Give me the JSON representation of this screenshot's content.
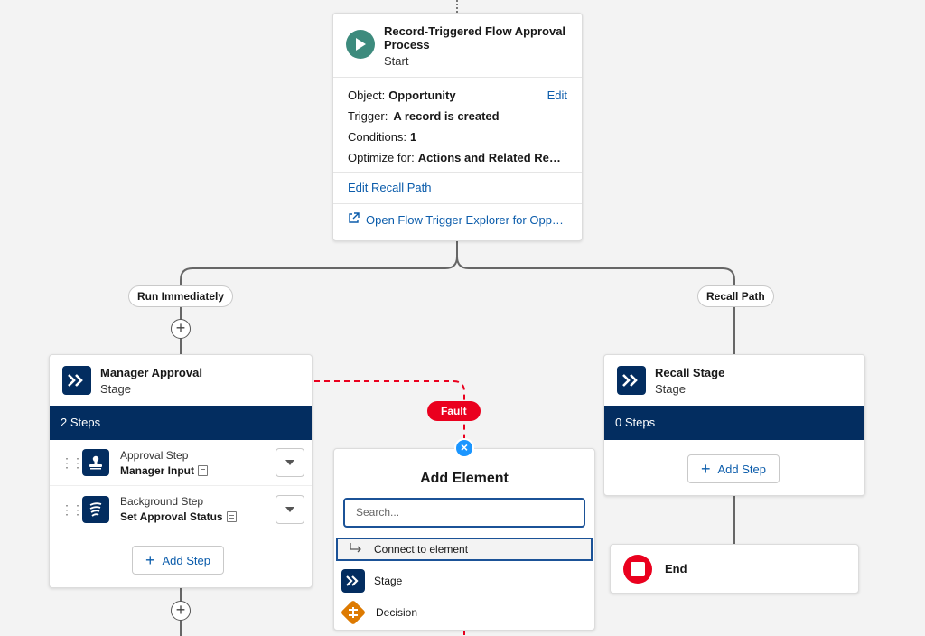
{
  "start": {
    "title": "Record-Triggered Flow Approval Process",
    "subtitle": "Start",
    "object_label": "Object:",
    "object_value": "Opportunity",
    "edit_label": "Edit",
    "trigger_label": "Trigger:",
    "trigger_value": "A record is created",
    "conditions_label": "Conditions:",
    "conditions_value": "1",
    "optimize_label": "Optimize for:",
    "optimize_value": "Actions and Related Rec…",
    "edit_recall_label": "Edit Recall Path",
    "open_explorer_label": "Open Flow Trigger Explorer for Opp…"
  },
  "paths": {
    "run_immediately": "Run Immediately",
    "recall_path": "Recall Path"
  },
  "manager_stage": {
    "title": "Manager Approval",
    "subtitle": "Stage",
    "steps_count": "2 Steps",
    "steps": [
      {
        "type": "Approval Step",
        "name": "Manager Input",
        "icon": "approval-icon"
      },
      {
        "type": "Background Step",
        "name": "Set Approval Status",
        "icon": "background-step-icon"
      }
    ],
    "add_step_label": "Add Step"
  },
  "recall_stage": {
    "title": "Recall Stage",
    "subtitle": "Stage",
    "steps_count": "0 Steps",
    "add_step_label": "Add Step"
  },
  "fault_label": "Fault",
  "add_element": {
    "title": "Add Element",
    "search_placeholder": "Search...",
    "connect_label": "Connect to element",
    "items": [
      {
        "label": "Stage",
        "icon": "stage-icon"
      },
      {
        "label": "Decision",
        "icon": "decision-icon"
      }
    ]
  },
  "end": {
    "label": "End"
  },
  "colors": {
    "navy": "#032d60",
    "fault_red": "#ea001e",
    "start_green": "#3d8b7d",
    "link_blue": "#0b5cab",
    "decision_orange": "#dd7a01"
  }
}
